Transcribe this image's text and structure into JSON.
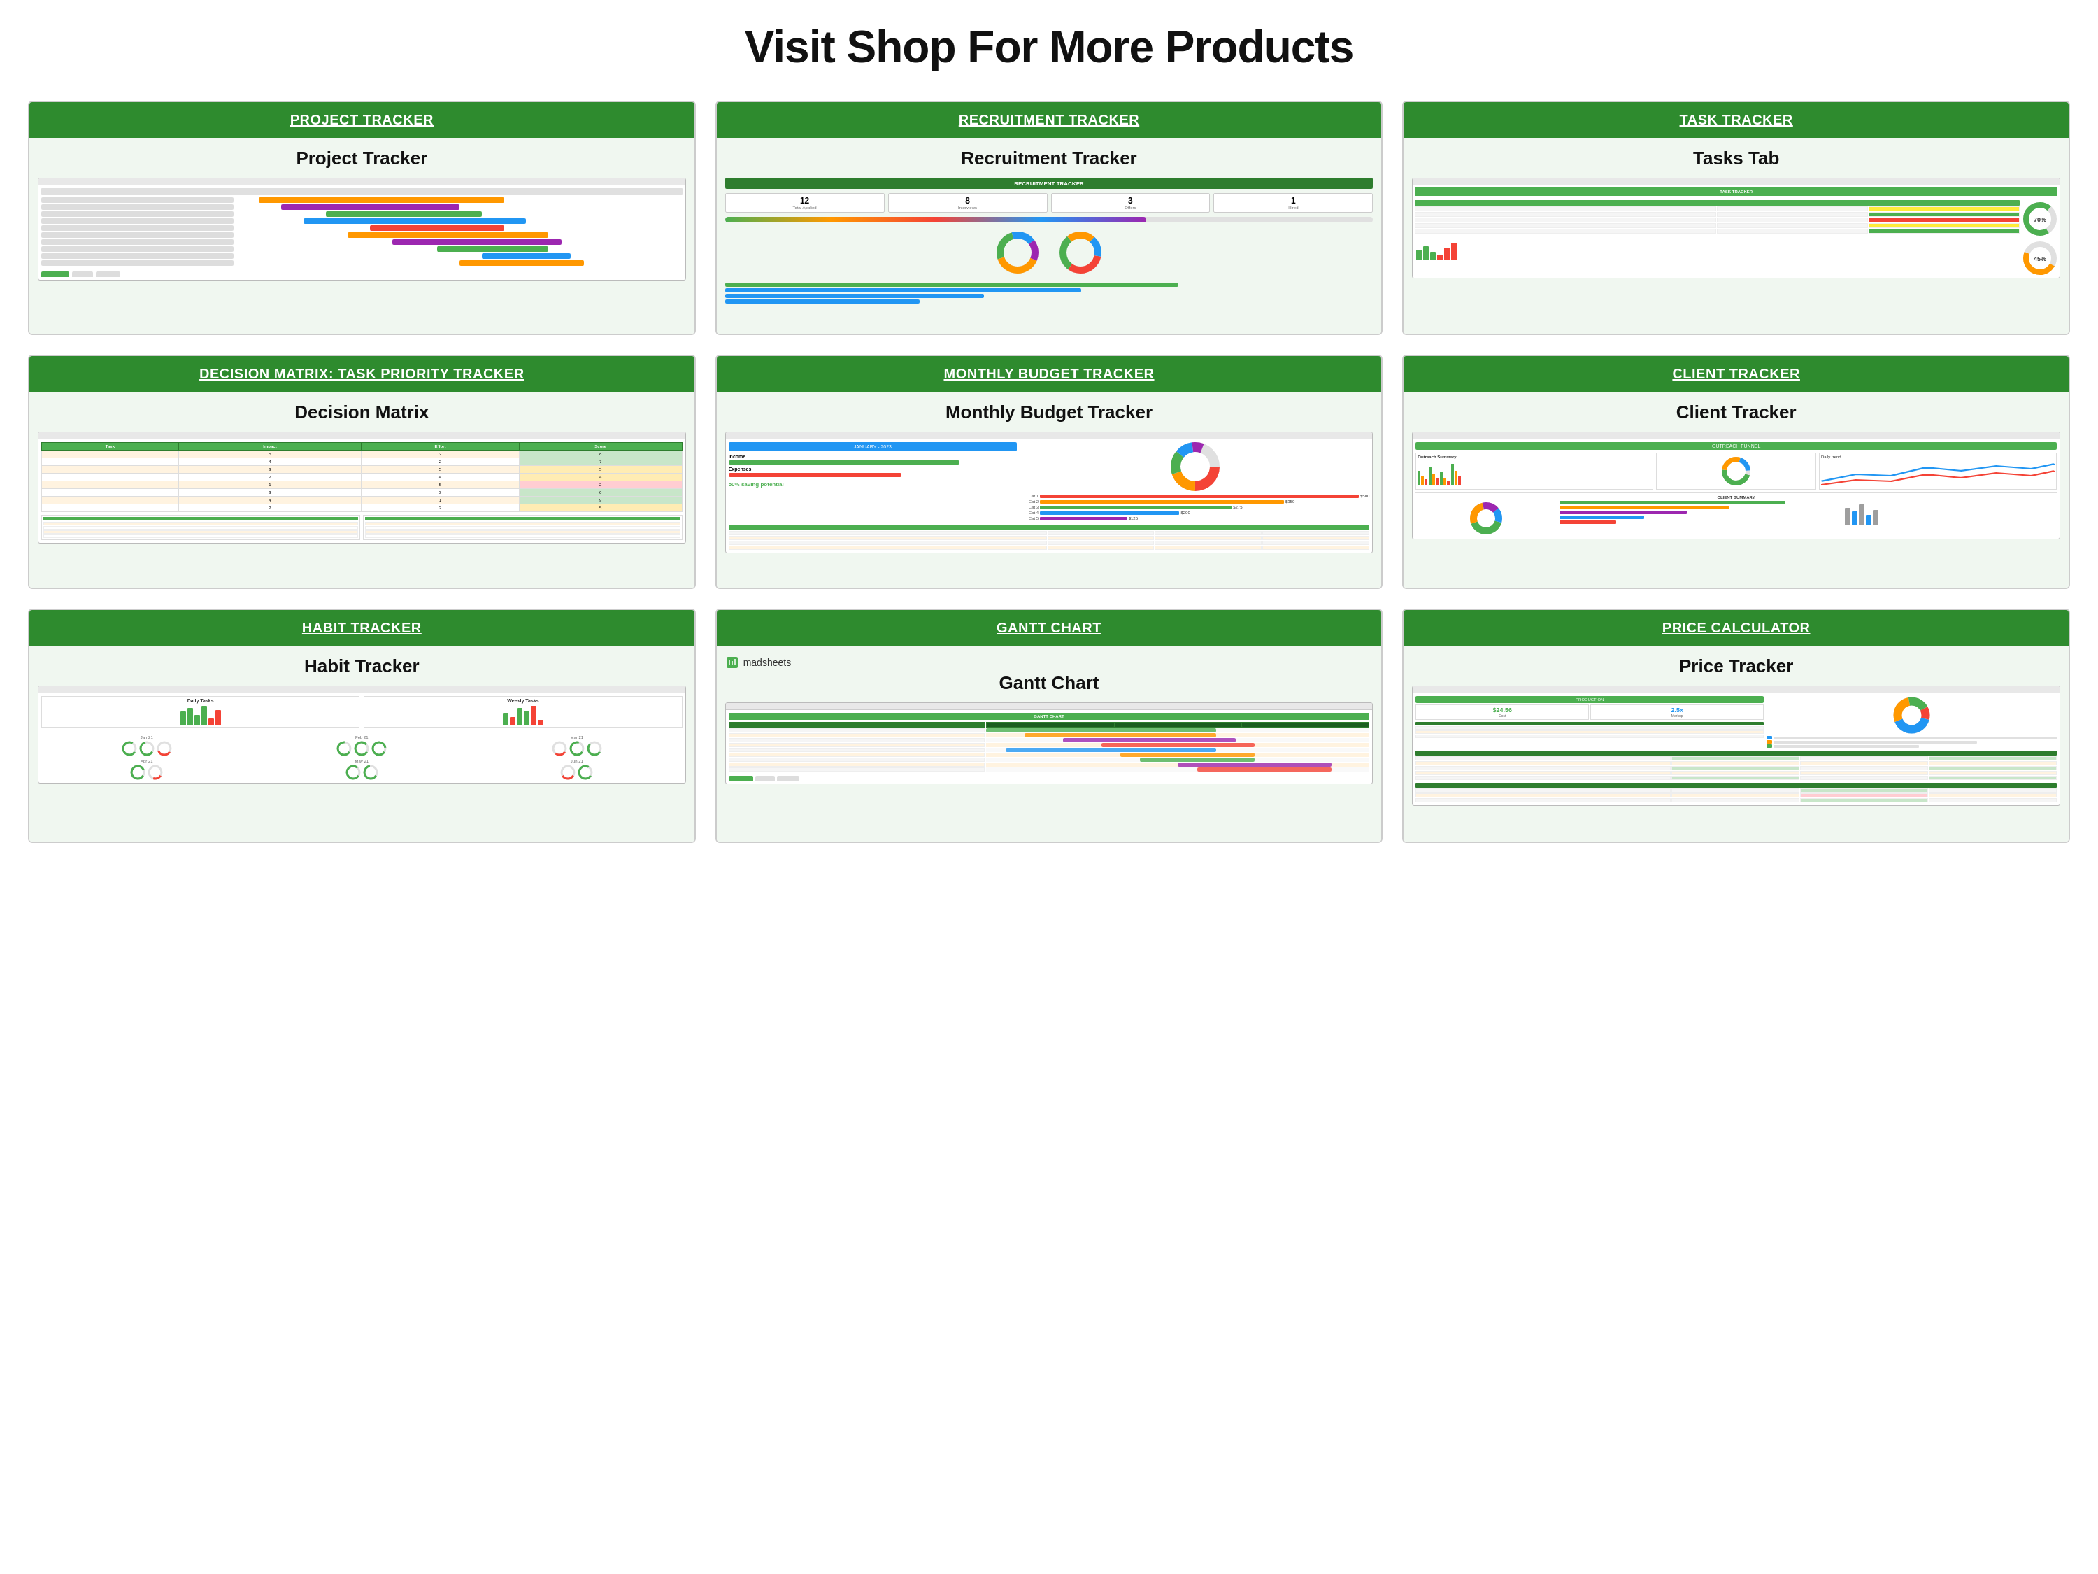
{
  "page": {
    "title": "Visit Shop For More Products"
  },
  "cards": [
    {
      "id": "project-tracker",
      "header": "PROJECT TRACKER",
      "subtitle": "Project Tracker",
      "type": "gantt"
    },
    {
      "id": "recruitment-tracker",
      "header": "RECRUITMENT TRACKER",
      "subtitle": "Recruitment Tracker",
      "type": "recruitment"
    },
    {
      "id": "task-tracker",
      "header": "TASK TRACKER",
      "subtitle": "Tasks Tab",
      "type": "task"
    },
    {
      "id": "decision-matrix",
      "header": "DECISION MATRIX: TASK PRIORITY TRACKER",
      "subtitle": "Decision Matrix",
      "type": "matrix"
    },
    {
      "id": "monthly-budget",
      "header": "MONTHLY BUDGET TRACKER",
      "subtitle": "Monthly Budget Tracker",
      "type": "budget"
    },
    {
      "id": "client-tracker",
      "header": "CLIENT TRACKER",
      "subtitle": "Client Tracker",
      "type": "client"
    },
    {
      "id": "habit-tracker",
      "header": "HABIT TRACKER",
      "subtitle": "Habit Tracker",
      "type": "habit"
    },
    {
      "id": "gantt-chart",
      "header": "GANTT CHART",
      "subtitle": "Gantt Chart",
      "type": "ganttchart"
    },
    {
      "id": "price-calculator",
      "header": "PRICE CALCULATOR",
      "subtitle": "Price Tracker",
      "type": "price"
    }
  ],
  "colors": {
    "green": "#2e8b2e",
    "lightgreen": "#4caf50",
    "orange": "#ff6600",
    "blue": "#2196f3",
    "purple": "#9c27b0",
    "red": "#f44336",
    "yellow": "#ffeb3b",
    "teal": "#009688",
    "pink": "#e91e63"
  }
}
